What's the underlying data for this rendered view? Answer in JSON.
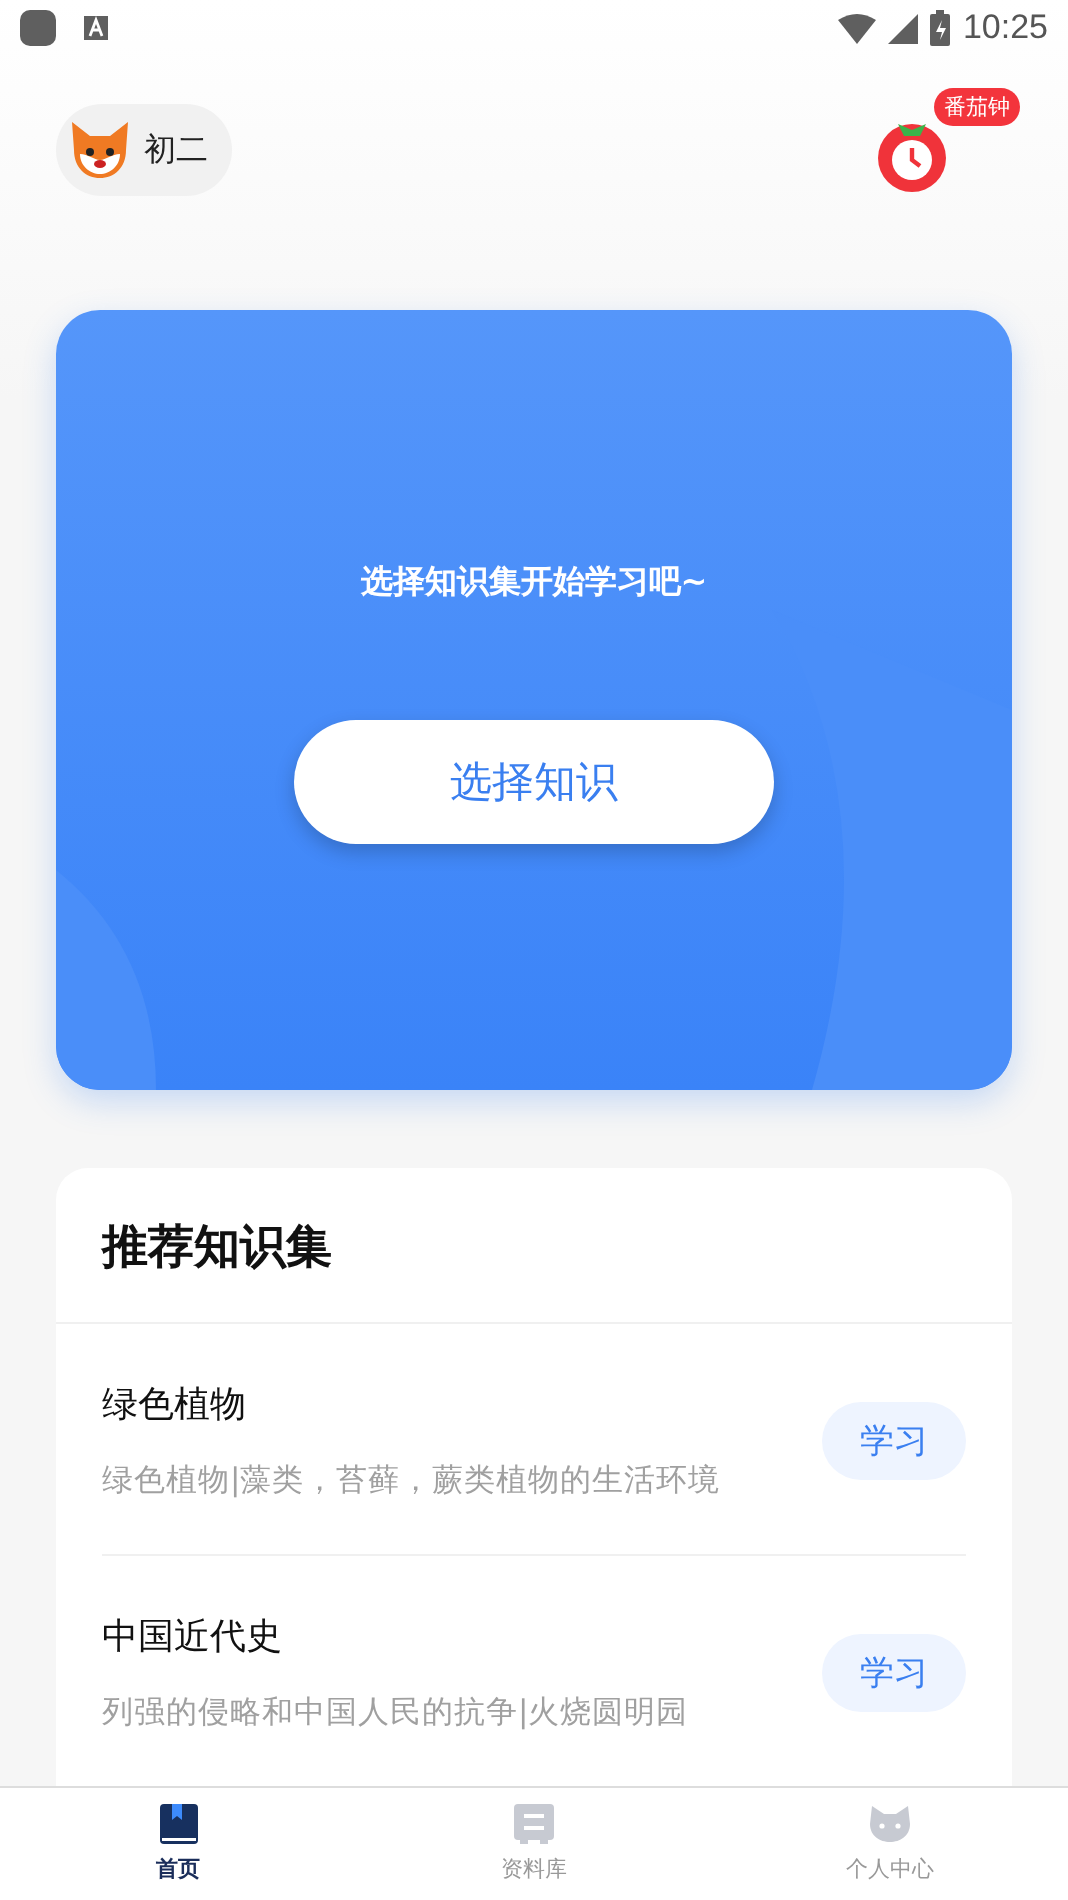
{
  "status_bar": {
    "time": "10:25"
  },
  "header": {
    "grade": "初二",
    "timer_badge": "番茄钟"
  },
  "hero": {
    "prompt": "选择知识集开始学习吧~",
    "button": "选择知识"
  },
  "recommend": {
    "title": "推荐知识集",
    "items": [
      {
        "title": "绿色植物",
        "subtitle": "绿色植物|藻类，苔藓，蕨类植物的生活环境",
        "action": "学习"
      },
      {
        "title": "中国近代史",
        "subtitle": "列强的侵略和中国人民的抗争|火烧圆明园",
        "action": "学习"
      }
    ]
  },
  "tabs": [
    {
      "kind": "home",
      "label": "首页",
      "selected": true
    },
    {
      "kind": "library",
      "label": "资料库",
      "selected": false
    },
    {
      "kind": "profile",
      "label": "个人中心",
      "selected": false
    }
  ]
}
